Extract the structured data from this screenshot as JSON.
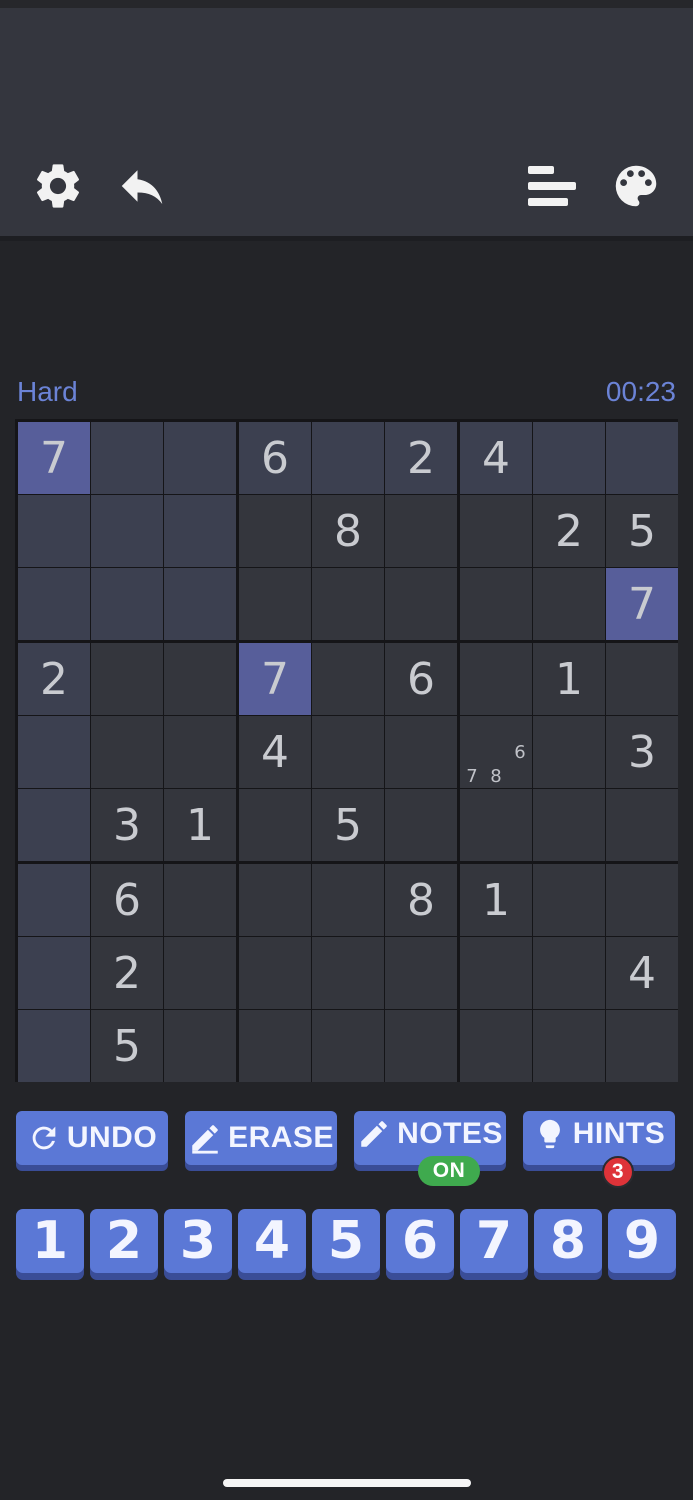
{
  "header": {
    "icons": [
      "gear-icon",
      "reply-icon",
      "stats-icon",
      "palette-icon"
    ]
  },
  "game": {
    "difficulty": "Hard",
    "timer": "00:23"
  },
  "board": {
    "rows": [
      [
        "7",
        "",
        "",
        "6",
        "",
        "2",
        "4",
        "",
        ""
      ],
      [
        "",
        "",
        "",
        "",
        "8",
        "",
        "",
        "2",
        "5"
      ],
      [
        "",
        "",
        "",
        "",
        "",
        "",
        "",
        "",
        "7"
      ],
      [
        "2",
        "",
        "",
        "7",
        "",
        "6",
        "",
        "1",
        ""
      ],
      [
        "",
        "",
        "",
        "4",
        "",
        "",
        "",
        "",
        "3"
      ],
      [
        "",
        "3",
        "1",
        "",
        "5",
        "",
        "",
        "",
        ""
      ],
      [
        "",
        "6",
        "",
        "",
        "",
        "8",
        "1",
        "",
        ""
      ],
      [
        "",
        "2",
        "",
        "",
        "",
        "",
        "",
        "",
        "4"
      ],
      [
        "",
        "5",
        "",
        "",
        "",
        "",
        "",
        "",
        ""
      ]
    ],
    "notes": [
      {
        "row": 4,
        "col": 6,
        "values": [
          "6",
          "7",
          "8"
        ]
      }
    ],
    "selected": {
      "row": 0,
      "col": 0
    },
    "highlight_color": "#575e9a",
    "region_color": "#3c4050"
  },
  "actions": {
    "undo": "UNDO",
    "erase": "ERASE",
    "notes": "NOTES",
    "notes_state": "ON",
    "hints": "HINTS",
    "hints_count": "3"
  },
  "numpad": [
    "1",
    "2",
    "3",
    "4",
    "5",
    "6",
    "7",
    "8",
    "9"
  ],
  "colors": {
    "accent": "#5b78d6",
    "on": "#3faa4e",
    "badge": "#de3339",
    "label": "#6b83d6"
  }
}
